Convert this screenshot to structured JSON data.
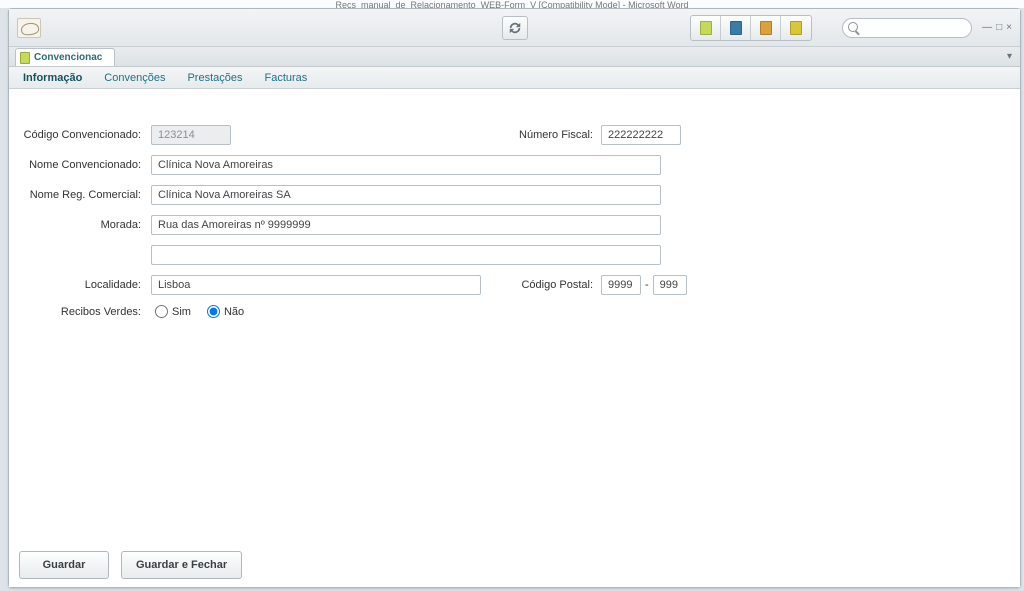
{
  "background_title": "Recs_manual_de_Relacionamento_WEB-Form_V [Compatibility Mode] - Microsoft Word",
  "toolbar": {
    "seg_colors": [
      "#c7d95b",
      "#3a7ba8",
      "#d9a23a",
      "#d9c73a"
    ]
  },
  "search": {
    "placeholder": ""
  },
  "doc_tab": {
    "label": "Convencionac"
  },
  "subnav": {
    "items": [
      "Informação",
      "Convenções",
      "Prestações",
      "Facturas"
    ],
    "active_index": 0
  },
  "form": {
    "labels": {
      "codigo": "Código Convencionado:",
      "fiscal": "Número Fiscal:",
      "nome_conv": "Nome Convencionado:",
      "nome_reg": "Nome Reg. Comercial:",
      "morada": "Morada:",
      "localidade": "Localidade:",
      "cod_postal": "Código Postal:",
      "recibos": "Recibos Verdes:"
    },
    "values": {
      "codigo": "123214",
      "fiscal": "222222222",
      "nome_conv": "Clínica Nova Amoreiras",
      "nome_reg": "Clínica Nova Amoreiras SA",
      "morada1": "Rua das Amoreiras nº 9999999",
      "morada2": "",
      "localidade": "Lisboa",
      "cp1": "9999",
      "cp2": "999"
    },
    "radio": {
      "sim": "Sim",
      "nao": "Não",
      "selected": "nao"
    },
    "cp_separator": "-"
  },
  "buttons": {
    "guardar": "Guardar",
    "guardar_fechar": "Guardar e Fechar"
  },
  "win_controls": {
    "min": "—",
    "max": "□",
    "close": "×"
  }
}
